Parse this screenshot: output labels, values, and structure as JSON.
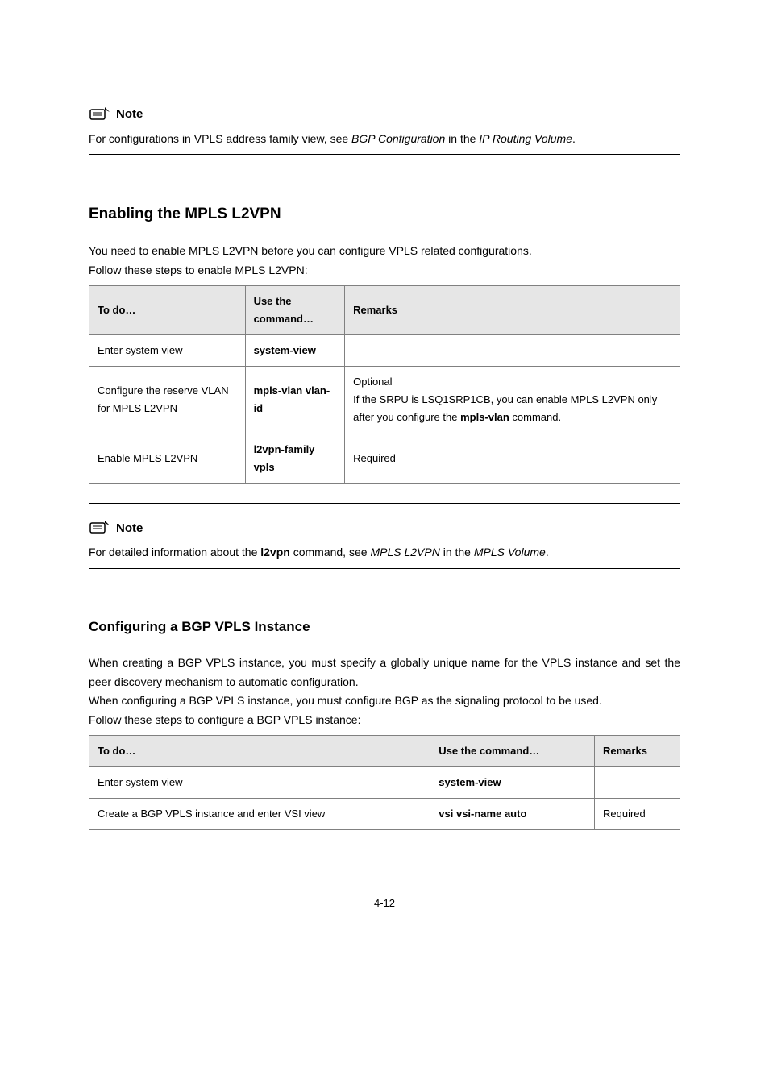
{
  "note1": {
    "label": "Note",
    "body_parts": [
      "For configurations in VPLS address family view, see ",
      "BGP Configuration",
      " in the ",
      "IP Routing Volume",
      "."
    ]
  },
  "section1": {
    "heading": "Enabling the MPLS L2VPN",
    "para1": "You need to enable MPLS L2VPN before you can configure VPLS related configurations.",
    "para2": "Follow these steps to enable MPLS L2VPN:"
  },
  "table1": {
    "h1": "To do…",
    "h2": "Use the command…",
    "h3": "Remarks",
    "rows": [
      {
        "c1": "Enter system view",
        "c2": "system-view",
        "c3": "—"
      },
      {
        "c1": "Configure the reserve VLAN for MPLS L2VPN",
        "c2": "mpls-vlan vlan-id",
        "c3_before": "Optional<br>If the SRPU is LSQ1SRP1CB, you can enable MPLS L2VPN only after you configure the ",
        "c3_italic": "mpls-vlan",
        "c3_after": " command."
      },
      {
        "c1": "Enable MPLS L2VPN",
        "c2": "l2vpn-family vpls",
        "c3": "Required"
      }
    ]
  },
  "note2": {
    "label": "Note",
    "body_parts": [
      "For detailed information about the ",
      "l2vpn",
      " command, see ",
      "MPLS L2VPN",
      " in the ",
      "MPLS Volume",
      "."
    ]
  },
  "section2": {
    "heading": "Configuring a BGP VPLS Instance",
    "para1": "When creating a BGP VPLS instance, you must specify a globally unique name for the VPLS instance and set the peer discovery mechanism to automatic configuration.",
    "para2": "When configuring a BGP VPLS instance, you must configure BGP as the signaling protocol to be used.",
    "para3": "Follow these steps to configure a BGP VPLS instance:"
  },
  "table2": {
    "h1": "To do…",
    "h2": "Use the command…",
    "h3": "Remarks",
    "rows": [
      {
        "c1": "Enter system view",
        "c2": "system-view",
        "c3": "—"
      },
      {
        "c1": "Create a BGP VPLS instance and enter VSI view",
        "c2": "vsi vsi-name auto",
        "c3": "Required"
      }
    ]
  },
  "page_num": "4-12"
}
